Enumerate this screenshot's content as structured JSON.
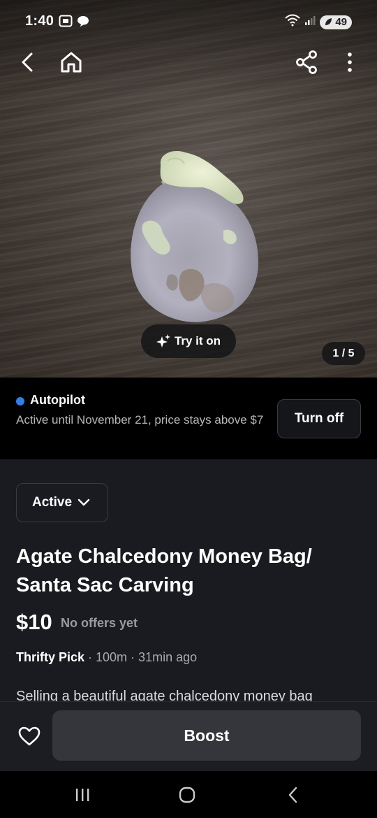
{
  "status_bar": {
    "time": "1:40",
    "battery": "49",
    "left_icons": [
      "screenshot-icon",
      "chat-bubble-icon"
    ],
    "right_icons": [
      "wifi-icon",
      "signal-icon",
      "battery-icon"
    ]
  },
  "top_nav": {
    "icons": [
      "back-icon",
      "home-icon",
      "share-icon",
      "more-icon"
    ]
  },
  "photo": {
    "try_on_label": "Try it on",
    "counter": "1 / 5"
  },
  "autopilot": {
    "title": "Autopilot",
    "description": "Active until November 21, price stays above $7",
    "button_label": "Turn off",
    "dot_color": "#2f7fe8"
  },
  "listing": {
    "status": "Active",
    "title": "Agate Chalcedony Money Bag/ Santa Sac Carving",
    "price": "$10",
    "offers": "No offers yet",
    "seller": "Thrifty Pick",
    "meta": " · 100m · 31min ago",
    "description_preview": "Selling a beautiful agate chalcedony money bag"
  },
  "action_bar": {
    "boost_label": "Boost"
  },
  "system_nav": {
    "icons": [
      "recents-icon",
      "home-circle-icon",
      "system-back-icon"
    ]
  }
}
